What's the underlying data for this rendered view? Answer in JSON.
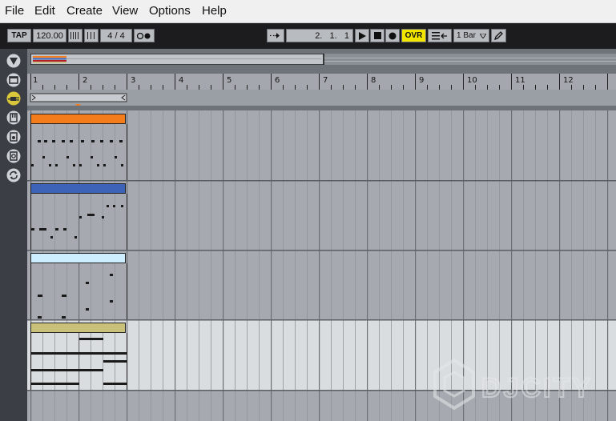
{
  "menubar": {
    "items": [
      "File",
      "Edit",
      "Create",
      "View",
      "Options",
      "Help"
    ]
  },
  "transport": {
    "tap_label": "TAP",
    "tempo": "120.00",
    "time_signature": "4 / 4",
    "position": "2.   1.   1",
    "ovr_label": "OVR",
    "quantize": "1 Bar",
    "ovr_color": "#f2e600"
  },
  "ruler": {
    "bars": [
      "1",
      "2",
      "3",
      "4",
      "5",
      "6",
      "7",
      "8",
      "9",
      "10",
      "11",
      "12"
    ]
  },
  "clips": [
    {
      "name": "orange-clip",
      "color": "#f47c1a"
    },
    {
      "name": "blue-clip",
      "color": "#3d63b8"
    },
    {
      "name": "lightblue-clip",
      "color": "#cdeeff"
    },
    {
      "name": "olive-clip",
      "color": "#c9c07a"
    }
  ],
  "sidebar": {
    "icons": [
      "triangle-down-icon",
      "browser-icon",
      "plug-icon",
      "instrument-icon",
      "drum-icon",
      "audio-effect-icon",
      "loop-icon"
    ]
  },
  "watermark": {
    "text": "DJCITY"
  }
}
